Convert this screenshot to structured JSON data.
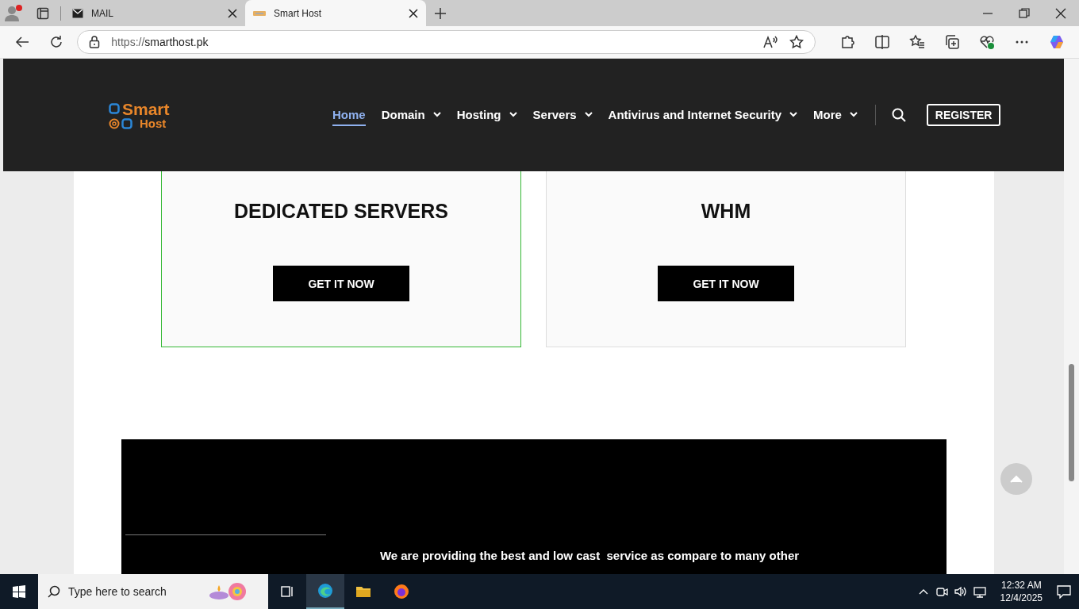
{
  "browser": {
    "tabs": [
      {
        "title": "MAIL",
        "selected": false
      },
      {
        "title": "Smart Host",
        "selected": true
      }
    ],
    "url_scheme": "https://",
    "url_host": "smarthost.pk"
  },
  "site": {
    "logo": {
      "top": "Smart",
      "bottom": "Host"
    },
    "nav": [
      {
        "label": "Home",
        "selected": true,
        "has_dropdown": false
      },
      {
        "label": "Domain",
        "selected": false,
        "has_dropdown": true
      },
      {
        "label": "Hosting",
        "selected": false,
        "has_dropdown": true
      },
      {
        "label": "Servers",
        "selected": false,
        "has_dropdown": true
      },
      {
        "label": "Antivirus and Internet Security",
        "selected": false,
        "has_dropdown": true
      },
      {
        "label": "More",
        "selected": false,
        "has_dropdown": true
      }
    ],
    "register": "REGISTER"
  },
  "cards": [
    {
      "title": "DEDICATED SERVERS",
      "button": "GET IT NOW",
      "highlighted": true
    },
    {
      "title": "WHM",
      "button": "GET IT NOW",
      "highlighted": false
    }
  ],
  "about": {
    "text": "We are providing the best and low cast  service as compare to many other"
  },
  "taskbar": {
    "search_placeholder": "Type here to search",
    "time": "12:32 AM",
    "date": "12/4/2025"
  }
}
